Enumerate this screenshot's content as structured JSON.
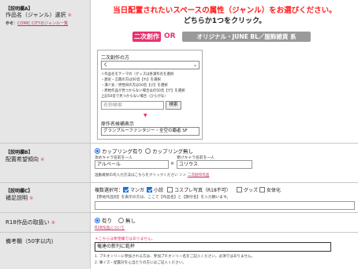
{
  "rowA": {
    "label": "【説明欄A】",
    "title": "作品名（ジャンル）選択",
    "required_mark": "※",
    "ref_prefix": "参考：",
    "ref_link": "COMIC CITYのジャンル一覧",
    "headline1": "当日配置されたいスペースの属性（ジャンル）をお選びください。",
    "headline2": "どちらか1つをクリック。",
    "btn_niji": "二次創作",
    "or_text": "OR",
    "btn_original": "オリジナル・JUNE BL／服飾雑貨 系",
    "panel_heading": "二次創作の方",
    "select_value": "く",
    "notes": [
      "＜作品名をテーマの（グッズは各漢作名を選択",
      "・歴史・言典の方は50音【れ】を選択",
      "・漢少女／男性同の方は50音【び】を選択",
      "・原始作品が見つからない場合はの50音【ゲ】を選択",
      "上記50音で見つからない場合（ひらがな）"
    ],
    "search_placeholder": "名称検索",
    "search_button": "検索",
    "list_label": "原作名候補表示",
    "list_value": "グランブルーファンタジー・全空の覇者 SF"
  },
  "rowB": {
    "label": "【説明欄B】",
    "title": "配置希望傾向",
    "required_mark": "※",
    "radio1": "カップリング有り",
    "radio2": "カップリング無し",
    "left_caption": "攻めキャラ名前を一人",
    "right_caption": "受けキャラ名前を一人",
    "left_value": "アルベール",
    "right_value": "ユリウス",
    "times": "×",
    "note": "温動確保の司入力方法はこちらをクリックください ＞＞",
    "note_link": "二次創作作品"
  },
  "rowC": {
    "label": "【説明欄C】",
    "title": "補足説明",
    "required_mark": "※",
    "checks_label": "複数選択可：",
    "checks": [
      {
        "label": "マンガ",
        "checked": true
      },
      {
        "label": "小説",
        "checked": true
      },
      {
        "label": "コスプレ写真（R18不可）",
        "checked": false
      },
      {
        "label": "グッズ",
        "checked": false
      },
      {
        "label": "女体化",
        "checked": false
      }
    ],
    "note": "【原始作品別】を表示の方は、ここで【作品名】と【旗付名】を入力願います。"
  },
  "rowR18": {
    "title": "R18作品の取扱い",
    "required_mark": "※",
    "radio1": "有り",
    "radio2": "無し",
    "note_link": "R18作品について"
  },
  "rowNote": {
    "title": "備考欄（50字以内）",
    "warn": "＊こちらは希望欄ではありません。",
    "value": "俺達の新刊に乾杯",
    "notes": [
      "1. プチオンリーに参加される方は、参加プチオンリー名をご記入ください。必須ではありません。",
      "2. 筆イズ・配置対を心当たりの方にはご記入ください。"
    ]
  },
  "colors": {
    "pink": "#e8336e",
    "headline_red": "#ff1a1a",
    "gray": "#9a9a9a",
    "blue": "#1a73e8"
  }
}
